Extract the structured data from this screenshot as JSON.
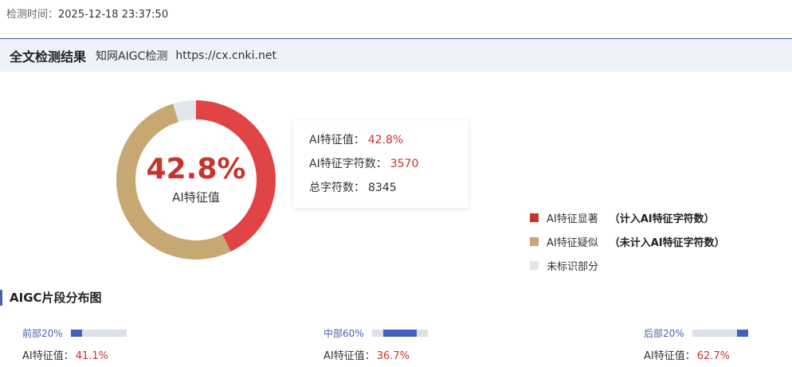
{
  "header": {
    "time_label": "检测时间：",
    "time_value": "2025-12-18 23:37:50",
    "title": "全文检测结果",
    "subtitle": "知网AIGC检测",
    "url": "https://cx.cnki.net"
  },
  "donut": {
    "percent_text": "42.8%",
    "caption": "AI特征值",
    "colors": {
      "significant": "#e04444",
      "suspected": "#c8a872",
      "unmarked": "#e3e6eb"
    }
  },
  "stats": {
    "ai_value_label": "AI特征值：",
    "ai_value": "42.8%",
    "ai_chars_label": "AI特征字符数：",
    "ai_chars": "3570",
    "total_chars_label": "总字符数：",
    "total_chars": "8345"
  },
  "legend": [
    {
      "label": "AI特征显著",
      "note": "（计入AI特征字符数）",
      "color": "#c8332f"
    },
    {
      "label": "AI特征疑似",
      "note": "（未计入AI特征字符数）",
      "color": "#c8a872"
    },
    {
      "label": "未标识部分",
      "note": "",
      "color": "#e3e6eb"
    }
  ],
  "section": {
    "title": "AIGC片段分布图"
  },
  "segments": [
    {
      "label": "前部20%",
      "value_label": "AI特征值：",
      "value": "41.1%",
      "range": [
        0,
        0.2
      ]
    },
    {
      "label": "中部60%",
      "value_label": "AI特征值：",
      "value": "36.7%",
      "range": [
        0.2,
        0.8
      ]
    },
    {
      "label": "后部20%",
      "value_label": "AI特征值：",
      "value": "62.7%",
      "range": [
        0.8,
        1.0
      ]
    }
  ],
  "chart_data": {
    "type": "pie",
    "categories": [
      "AI特征显著",
      "AI特征疑似",
      "未标识部分"
    ],
    "values": [
      42.8,
      52.5,
      4.7
    ]
  }
}
